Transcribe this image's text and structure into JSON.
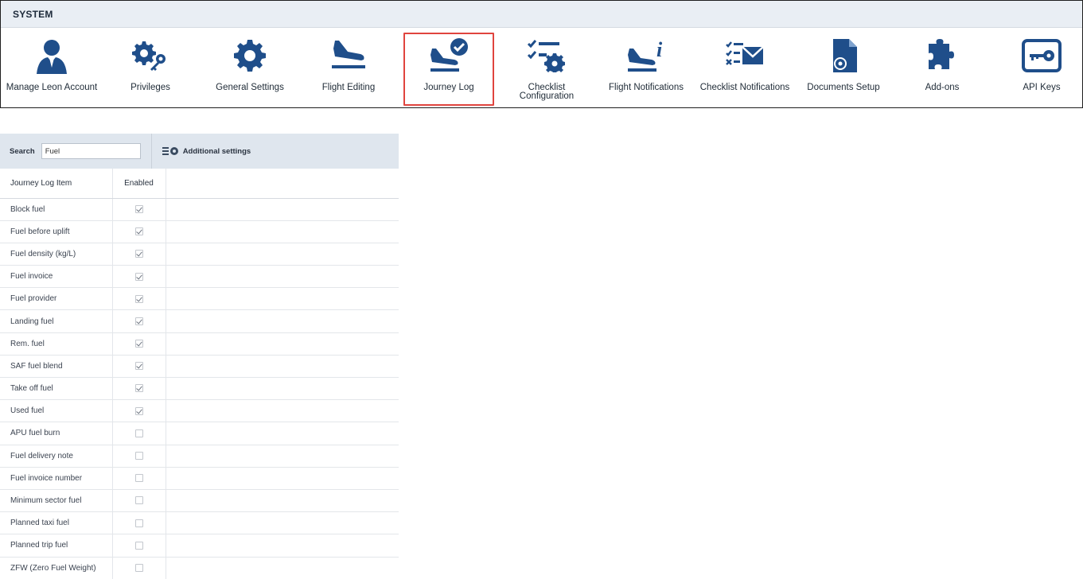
{
  "system": {
    "title": "SYSTEM",
    "tiles": [
      {
        "label": "Manage Leon Account",
        "icon": "user-icon"
      },
      {
        "label": "Privileges",
        "icon": "gear-key-icon"
      },
      {
        "label": "General Settings",
        "icon": "gear-icon"
      },
      {
        "label": "Flight Editing",
        "icon": "plane-landing-icon"
      },
      {
        "label": "Journey Log",
        "icon": "plane-check-icon",
        "selected": true
      },
      {
        "label": "Checklist Configuration",
        "icon": "checklist-gear-icon"
      },
      {
        "label": "Flight Notifications",
        "icon": "plane-info-icon"
      },
      {
        "label": "Checklist Notifications",
        "icon": "checklist-mail-icon"
      },
      {
        "label": "Documents Setup",
        "icon": "document-gear-icon"
      },
      {
        "label": "Add-ons",
        "icon": "puzzle-icon"
      },
      {
        "label": "API Keys",
        "icon": "key-icon"
      }
    ]
  },
  "toolbar": {
    "search_label": "Search",
    "search_value": "Fuel",
    "additional_settings_label": "Additional settings"
  },
  "table": {
    "headers": {
      "item": "Journey Log Item",
      "enabled": "Enabled"
    },
    "rows": [
      {
        "item": "Block fuel",
        "enabled": true
      },
      {
        "item": "Fuel before uplift",
        "enabled": true
      },
      {
        "item": "Fuel density (kg/L)",
        "enabled": true
      },
      {
        "item": "Fuel invoice",
        "enabled": true
      },
      {
        "item": "Fuel provider",
        "enabled": true
      },
      {
        "item": "Landing fuel",
        "enabled": true
      },
      {
        "item": "Rem. fuel",
        "enabled": true
      },
      {
        "item": "SAF fuel blend",
        "enabled": true
      },
      {
        "item": "Take off fuel",
        "enabled": true
      },
      {
        "item": "Used fuel",
        "enabled": true
      },
      {
        "item": "APU fuel burn",
        "enabled": false
      },
      {
        "item": "Fuel delivery note",
        "enabled": false
      },
      {
        "item": "Fuel invoice number",
        "enabled": false
      },
      {
        "item": "Minimum sector fuel",
        "enabled": false
      },
      {
        "item": "Planned taxi fuel",
        "enabled": false
      },
      {
        "item": "Planned trip fuel",
        "enabled": false
      },
      {
        "item": "ZFW (Zero Fuel Weight)",
        "enabled": false
      }
    ]
  },
  "colors": {
    "icon": "#1f4e8a",
    "highlight": "#e0443e",
    "header_bg": "#e9eef4"
  }
}
